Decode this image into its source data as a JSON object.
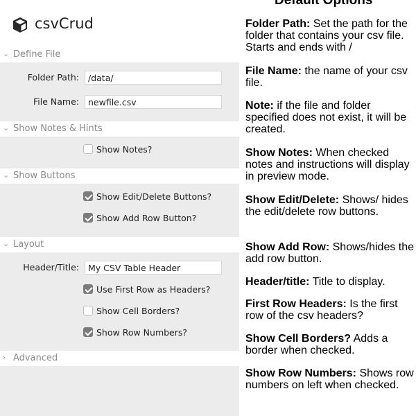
{
  "app": {
    "title": "csvCrud",
    "logo_icon": "cube-icon"
  },
  "sections": {
    "define_file": {
      "label": "Define File",
      "expanded": true
    },
    "show_notes_hints": {
      "label": "Show Notes & Hints",
      "expanded": true
    },
    "show_buttons": {
      "label": "Show Buttons",
      "expanded": true
    },
    "layout": {
      "label": "Layout",
      "expanded": true
    },
    "advanced": {
      "label": "Advanced",
      "expanded": false
    }
  },
  "fields": {
    "folder_path": {
      "label": "Folder Path:",
      "value": "/data/"
    },
    "file_name": {
      "label": "File Name:",
      "value": "newfile.csv"
    },
    "header_title": {
      "label": "Header/Title:",
      "value": "My CSV Table Header"
    }
  },
  "checkboxes": {
    "show_notes": {
      "label": "Show Notes?",
      "checked": false
    },
    "show_edit_delete": {
      "label": "Show Edit/Delete Buttons?",
      "checked": true
    },
    "show_add_row": {
      "label": "Show Add Row Button?",
      "checked": true
    },
    "first_row_headers": {
      "label": "Use First Row as Headers?",
      "checked": true
    },
    "show_cell_borders": {
      "label": "Show Cell Borders?",
      "checked": false
    },
    "show_row_numbers": {
      "label": "Show Row Numbers?",
      "checked": true
    }
  },
  "help": {
    "heading": "Default Options",
    "items": [
      {
        "term": "Folder Path:",
        "desc": " Set the path for the folder that contains your csv file. Starts and ends with /"
      },
      {
        "term": "File Name:",
        "desc": " the name of your csv file."
      },
      {
        "term": "Note:",
        "desc": " if the file and folder specified does not exist, it will be created."
      },
      {
        "term": "Show Notes:",
        "desc": " When checked notes and instructions will display in preview mode."
      },
      {
        "term": "Show Edit/Delete:",
        "desc": " Shows/ hides the edit/delete row buttons."
      },
      {
        "term": "Show Add Row:",
        "desc": " Shows/hides the add row button."
      },
      {
        "term": "Header/title:",
        "desc": " Title to display."
      },
      {
        "term": "First Row Headers:",
        "desc": " Is the first row of the csv headers?"
      },
      {
        "term": "Show Cell Borders?",
        "desc": " Adds a border when checked."
      },
      {
        "term": "Show Row Numbers:",
        "desc": " Shows row numbers on left when checked."
      }
    ]
  }
}
